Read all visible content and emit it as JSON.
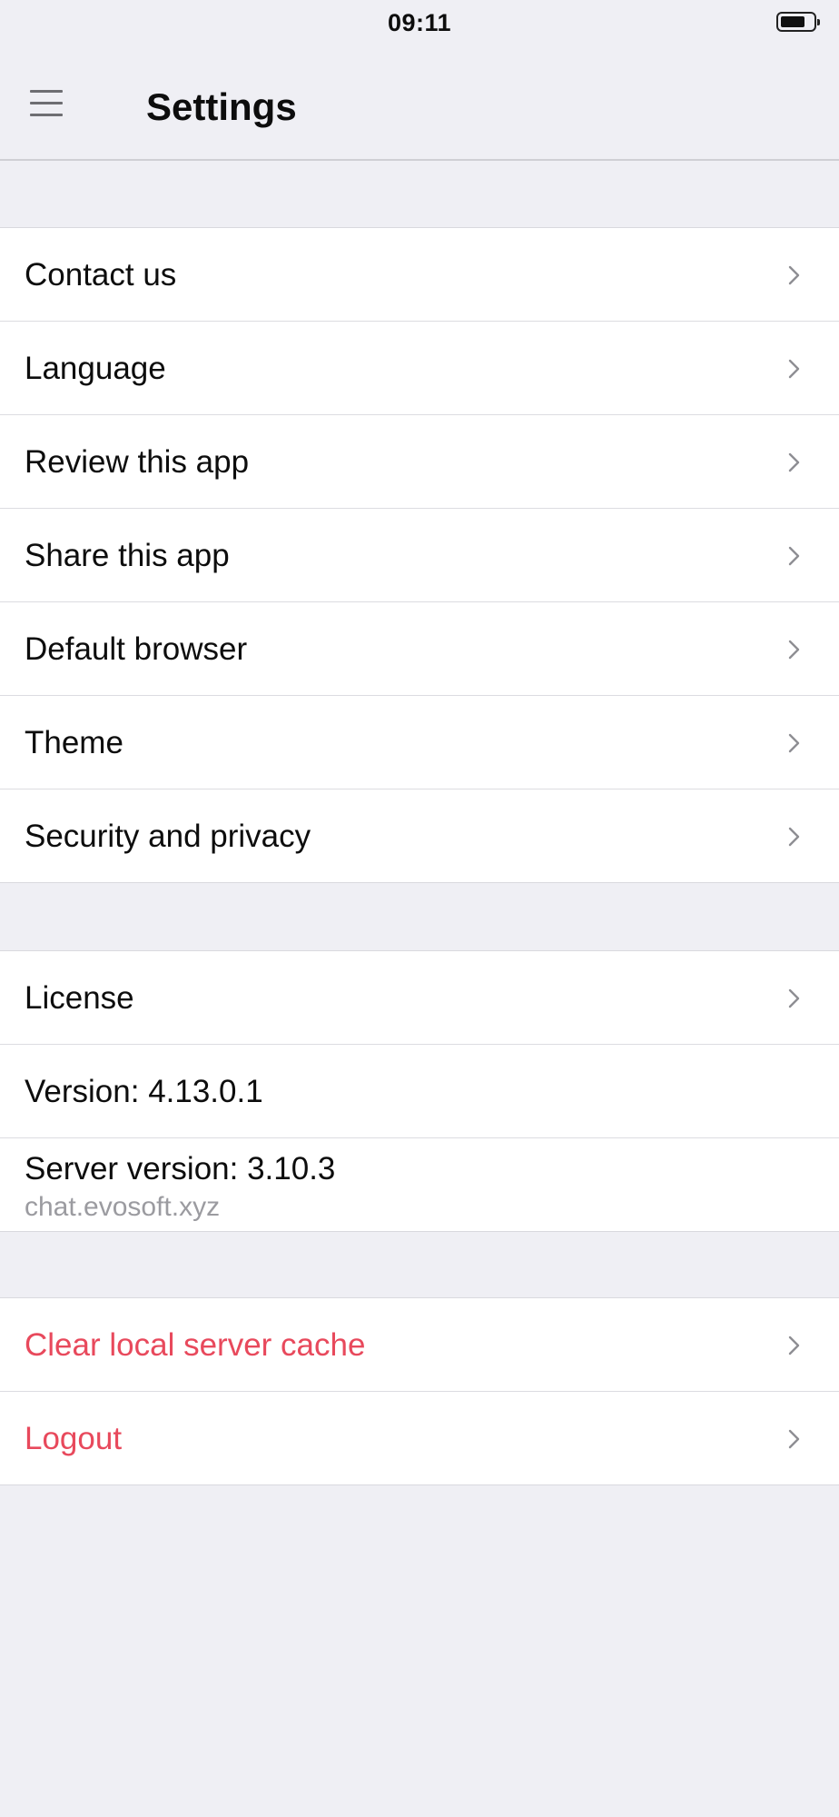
{
  "status_bar": {
    "time": "09:11",
    "battery_level": 0.75
  },
  "header": {
    "title": "Settings",
    "menu_icon": "hamburger-menu-icon"
  },
  "groups": {
    "general": [
      {
        "label": "Contact us"
      },
      {
        "label": "Language"
      },
      {
        "label": "Review this app"
      },
      {
        "label": "Share this app"
      },
      {
        "label": "Default browser"
      },
      {
        "label": "Theme"
      },
      {
        "label": "Security and privacy"
      }
    ],
    "info": {
      "license": "License",
      "version": "Version: 4.13.0.1",
      "server_version": "Server version: 3.10.3",
      "server_host": "chat.evosoft.xyz"
    },
    "danger": {
      "clear_cache": "Clear local server cache",
      "logout": "Logout"
    }
  },
  "colors": {
    "background": "#efeff4",
    "danger": "#e8495c",
    "secondary_text": "#9b9ba0",
    "chevron": "#8e8e93"
  },
  "icons": {
    "row_chevron": "chevron-right-icon",
    "battery": "battery-icon"
  }
}
